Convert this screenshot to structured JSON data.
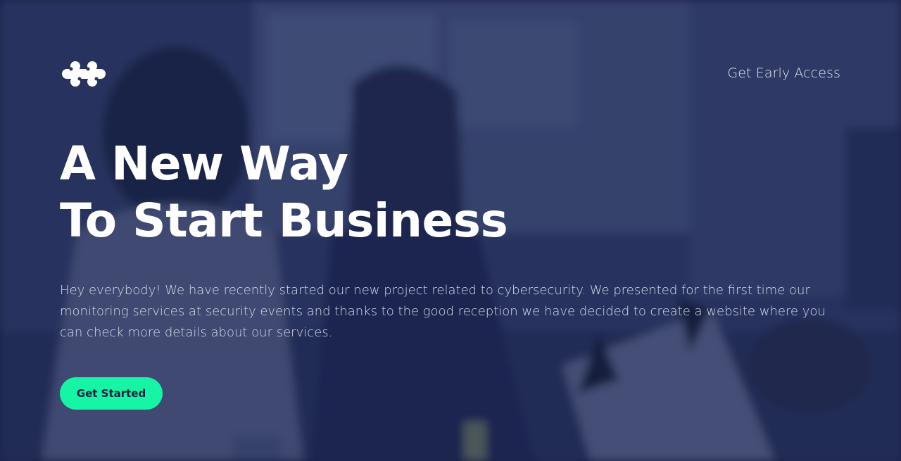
{
  "brand": {
    "logo_icon": "molecule-logo-icon"
  },
  "nav": {
    "early_access_label": "Get Early Access"
  },
  "hero": {
    "headline_line1": "A New Way",
    "headline_line2": "To Start Business",
    "description": "Hey everybody! We have recently started our new project related to cybersecurity. We presented for the first time our monitoring services at security events and thanks to the good reception we have decided to create a website where you can check more details about our services.",
    "cta_label": "Get Started"
  },
  "colors": {
    "overlay": "#1b2346",
    "accent": "#16f4a5",
    "heading": "#ffffff",
    "body_text": "#d7dbe8"
  }
}
